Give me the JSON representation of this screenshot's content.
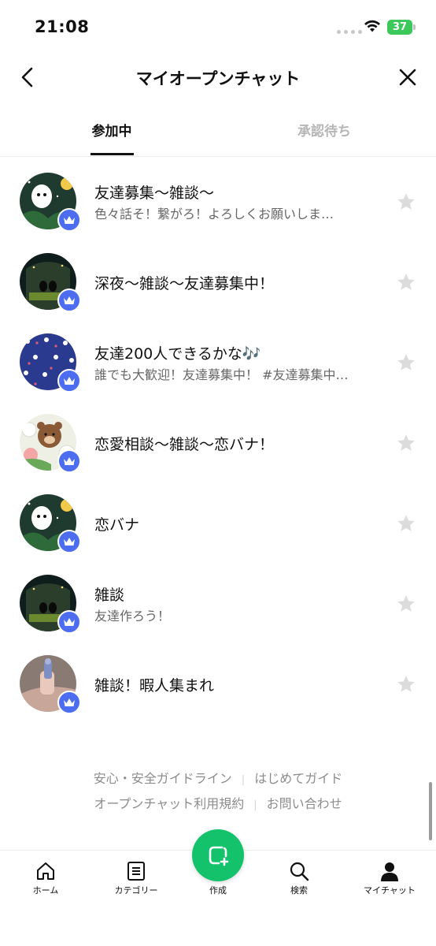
{
  "status_bar": {
    "time": "21:08",
    "battery": "37"
  },
  "header": {
    "title": "マイオープンチャット"
  },
  "tabs": [
    {
      "label": "参加中",
      "active": true
    },
    {
      "label": "承認待ち",
      "active": false
    }
  ],
  "chats": [
    {
      "title": "友達募集〜雑談〜",
      "desc": "色々話そ！繋がろ！よろしくお願いしま…",
      "avatar": "moon-stars",
      "role_icon": "crown-icon",
      "starred": false
    },
    {
      "title": "深夜〜雑談〜友達募集中！",
      "desc": "",
      "avatar": "night-silhouette",
      "role_icon": "crown-icon",
      "starred": false
    },
    {
      "title": "友達200人できるかな🎶",
      "desc": "誰でも大歓迎！友達募集中！ #友達募集中…",
      "avatar": "pattern-blue",
      "role_icon": "crown-icon",
      "starred": false
    },
    {
      "title": "恋愛相談〜雑談〜恋バナ！",
      "desc": "",
      "avatar": "bear-flowers",
      "role_icon": "crown-icon",
      "starred": false
    },
    {
      "title": "恋バナ",
      "desc": "",
      "avatar": "moon-stars",
      "role_icon": "crown-icon",
      "starred": false
    },
    {
      "title": "雑談",
      "desc": "友達作ろう！",
      "avatar": "night-silhouette",
      "role_icon": "crown-icon",
      "starred": false
    },
    {
      "title": "雑談！暇人集まれ",
      "desc": "",
      "avatar": "hand-photo",
      "role_icon": "crown-icon",
      "starred": false
    }
  ],
  "footer": {
    "links": [
      "安心・安全ガイドライン",
      "はじめてガイド",
      "オープンチャット利用規約",
      "お問い合わせ"
    ]
  },
  "bottom_nav": [
    {
      "label": "ホーム",
      "icon": "home-icon"
    },
    {
      "label": "カテゴリー",
      "icon": "category-icon"
    },
    {
      "label": "作成",
      "icon": "create-chat-icon"
    },
    {
      "label": "検索",
      "icon": "search-icon"
    },
    {
      "label": "マイチャット",
      "icon": "person-icon"
    }
  ],
  "colors": {
    "accent_green": "#13c26a",
    "badge_blue": "#4c6df0",
    "battery_green": "#3cc85a"
  }
}
